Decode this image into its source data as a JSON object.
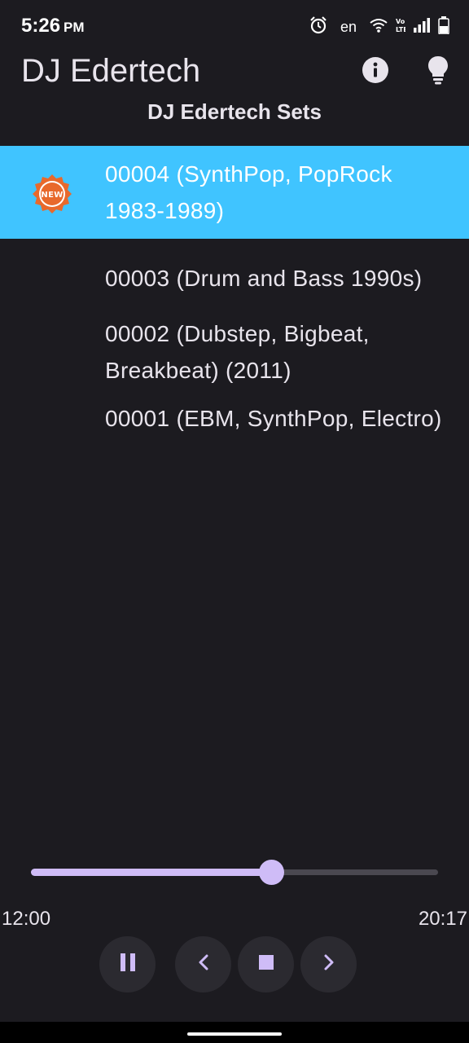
{
  "status_bar": {
    "time": "5:26",
    "ampm": "PM",
    "language": "en",
    "icons": [
      "alarm-icon",
      "wifi-icon",
      "volte-icon",
      "signal-icon",
      "battery-icon"
    ]
  },
  "app_bar": {
    "title": "DJ Edertech",
    "actions": [
      "info-icon",
      "lightbulb-icon"
    ]
  },
  "section_title": "DJ Edertech Sets",
  "sets": [
    {
      "label": "00004 (SynthPop, PopRock 1983-1989)",
      "selected": true,
      "badge": "NEW"
    },
    {
      "label": "00003 (Drum and Bass 1990s)",
      "selected": false
    },
    {
      "label": "00002 (Dubstep, Bigbeat, Breakbeat) (2011)",
      "selected": false
    },
    {
      "label": "00001 (EBM, SynthPop, Electro)",
      "selected": false
    }
  ],
  "player": {
    "elapsed": "12:00",
    "total": "20:17",
    "progress": 0.59,
    "controls": [
      "pause-icon",
      "previous-icon",
      "stop-icon",
      "next-icon"
    ]
  },
  "colors": {
    "background": "#1c1b20",
    "selected_row": "#40c4ff",
    "accent": "#cfbcf7",
    "badge": "#e8692c"
  }
}
